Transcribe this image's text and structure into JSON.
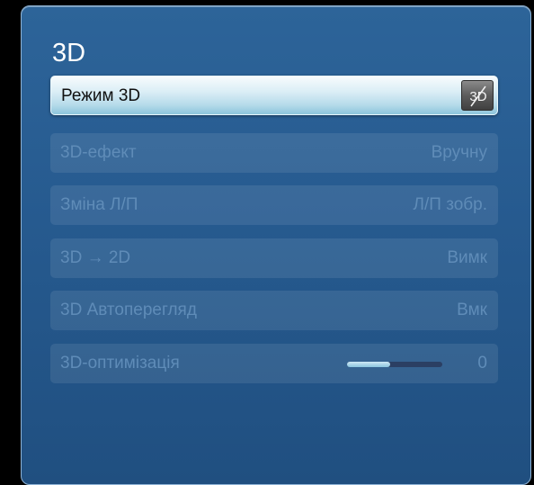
{
  "menu": {
    "title": "3D",
    "items": [
      {
        "label": "Режим 3D",
        "value": "",
        "icon": "3d-off-icon",
        "selected": true
      },
      {
        "label": "3D-ефект",
        "value": "Вручну"
      },
      {
        "label": "Зміна Л/П",
        "value": "Л/П зобр."
      },
      {
        "label": "3D → 2D",
        "value": "Вимк"
      },
      {
        "label": "3D Автоперегляд",
        "value": "Вмк"
      },
      {
        "label": "3D-оптимізація",
        "value": "0",
        "slider_fraction": 0.45
      }
    ]
  },
  "mode_icon": {
    "text": "3D"
  },
  "colors": {
    "panel_bg": "#265a8f",
    "selected_bg": "#b6dbea",
    "disabled_text": "#5f8cb8",
    "slider_fill": "#8cc6df"
  }
}
